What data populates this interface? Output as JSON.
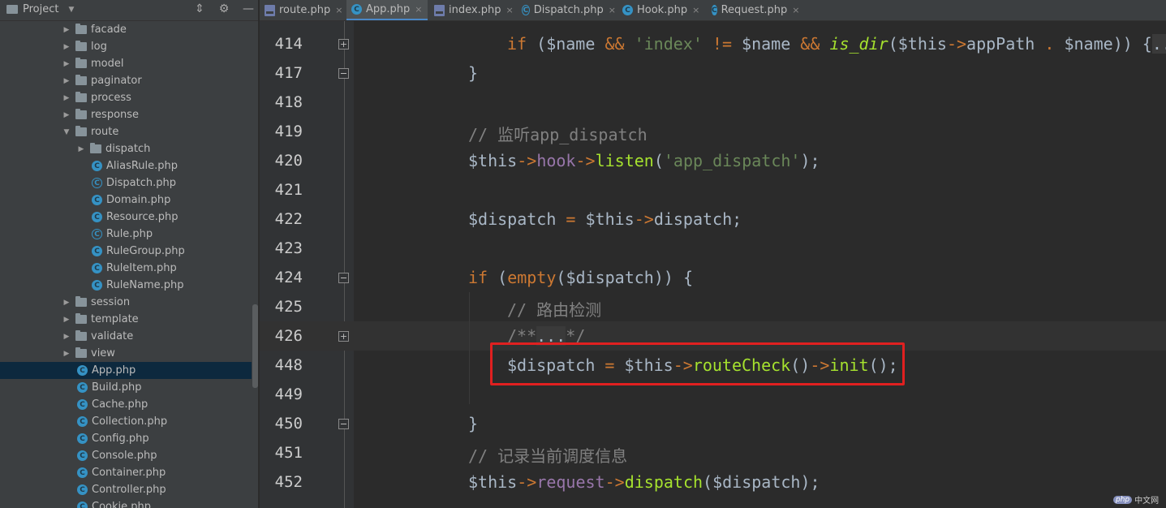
{
  "project_panel": {
    "title": "Project",
    "tree": [
      {
        "type": "folder",
        "label": "facade",
        "depth": 1,
        "expanded": false
      },
      {
        "type": "folder",
        "label": "log",
        "depth": 1,
        "expanded": false
      },
      {
        "type": "folder",
        "label": "model",
        "depth": 1,
        "expanded": false
      },
      {
        "type": "folder",
        "label": "paginator",
        "depth": 1,
        "expanded": false
      },
      {
        "type": "folder",
        "label": "process",
        "depth": 1,
        "expanded": false
      },
      {
        "type": "folder",
        "label": "response",
        "depth": 1,
        "expanded": false
      },
      {
        "type": "folder",
        "label": "route",
        "depth": 1,
        "expanded": true
      },
      {
        "type": "folder",
        "label": "dispatch",
        "depth": 2,
        "expanded": false
      },
      {
        "type": "class",
        "label": "AliasRule.php",
        "depth": 2
      },
      {
        "type": "abstract",
        "label": "Dispatch.php",
        "depth": 2
      },
      {
        "type": "class",
        "label": "Domain.php",
        "depth": 2
      },
      {
        "type": "class",
        "label": "Resource.php",
        "depth": 2
      },
      {
        "type": "abstract",
        "label": "Rule.php",
        "depth": 2
      },
      {
        "type": "class",
        "label": "RuleGroup.php",
        "depth": 2
      },
      {
        "type": "class",
        "label": "RuleItem.php",
        "depth": 2
      },
      {
        "type": "class",
        "label": "RuleName.php",
        "depth": 2
      },
      {
        "type": "folder",
        "label": "session",
        "depth": 1,
        "expanded": false
      },
      {
        "type": "folder",
        "label": "template",
        "depth": 1,
        "expanded": false
      },
      {
        "type": "folder",
        "label": "validate",
        "depth": 1,
        "expanded": false
      },
      {
        "type": "folder",
        "label": "view",
        "depth": 1,
        "expanded": false
      },
      {
        "type": "class",
        "label": "App.php",
        "depth": 1,
        "selected": true
      },
      {
        "type": "class",
        "label": "Build.php",
        "depth": 1
      },
      {
        "type": "class",
        "label": "Cache.php",
        "depth": 1
      },
      {
        "type": "class",
        "label": "Collection.php",
        "depth": 1
      },
      {
        "type": "class",
        "label": "Config.php",
        "depth": 1
      },
      {
        "type": "class",
        "label": "Console.php",
        "depth": 1
      },
      {
        "type": "class",
        "label": "Container.php",
        "depth": 1
      },
      {
        "type": "class",
        "label": "Controller.php",
        "depth": 1
      },
      {
        "type": "class",
        "label": "Cookie.php",
        "depth": 1
      }
    ]
  },
  "tabs": [
    {
      "label": "route.php",
      "icon": "php-file-icon",
      "active": false
    },
    {
      "label": "App.php",
      "icon": "class-icon",
      "active": true
    },
    {
      "label": "index.php",
      "icon": "php-file-icon",
      "active": false
    },
    {
      "label": "Dispatch.php",
      "icon": "abstract-class-icon",
      "active": false
    },
    {
      "label": "Hook.php",
      "icon": "class-icon",
      "active": false
    },
    {
      "label": "Request.php",
      "icon": "class-icon",
      "active": false
    }
  ],
  "editor": {
    "lines": [
      {
        "num": "414",
        "fold": "+"
      },
      {
        "num": "417",
        "fold": "-"
      },
      {
        "num": "418",
        "fold": ""
      },
      {
        "num": "419",
        "fold": ""
      },
      {
        "num": "420",
        "fold": ""
      },
      {
        "num": "421",
        "fold": ""
      },
      {
        "num": "422",
        "fold": ""
      },
      {
        "num": "423",
        "fold": ""
      },
      {
        "num": "424",
        "fold": "-"
      },
      {
        "num": "425",
        "fold": ""
      },
      {
        "num": "426",
        "fold": "+"
      },
      {
        "num": "448",
        "fold": ""
      },
      {
        "num": "449",
        "fold": ""
      },
      {
        "num": "450",
        "fold": "-"
      },
      {
        "num": "451",
        "fold": ""
      },
      {
        "num": "452",
        "fold": ""
      }
    ],
    "code": {
      "l414": {
        "if": "if",
        "p1": " (",
        "name1": "$name",
        "and1": " && ",
        "s_index": "'index'",
        "neq": " != ",
        "name2": "$name",
        "and2": " && ",
        "isdir": "is_dir",
        "p2": "(",
        "this1": "$this",
        "arr1": "->",
        "appPath": "appPath",
        "dot": " . ",
        "name3": "$name",
        "p3": ")) {",
        "fold": "..."
      },
      "l417": "}",
      "l419": "// 监听app_dispatch",
      "l420": {
        "this": "$this",
        "a1": "->",
        "hook": "hook",
        "a2": "->",
        "listen": "listen",
        "p1": "(",
        "str": "'app_dispatch'",
        "p2": ");"
      },
      "l422": {
        "v": "$dispatch",
        "eq": " = ",
        "this": "$this",
        "a1": "->",
        "prop": "dispatch",
        "end": ";"
      },
      "l424": {
        "if": "if",
        "p1": " (",
        "empty": "empty",
        "p2": "(",
        "v": "$dispatch",
        "p3": ")) {"
      },
      "l425": "// 路由检测",
      "l426": {
        "start": "/**",
        "fold": "...",
        "end": "*/"
      },
      "l448": {
        "v": "$dispatch",
        "eq": " = ",
        "this": "$this",
        "a1": "->",
        "routeCheck": "routeCheck",
        "p1": "()",
        "a2": "->",
        "init": "init",
        "p2": "();"
      },
      "l450": "}",
      "l451": "// 记录当前调度信息",
      "l452": {
        "this": "$this",
        "a1": "->",
        "request": "request",
        "a2": "->",
        "dispatch": "dispatch",
        "p1": "(",
        "v": "$dispatch",
        "p2": ");"
      }
    }
  },
  "watermark": {
    "logo": "php",
    "text": "中文网"
  },
  "colors": {
    "highlight_box": "#e02020",
    "active_tab_underline": "#4a88c7",
    "selected_row": "#0d293e"
  }
}
